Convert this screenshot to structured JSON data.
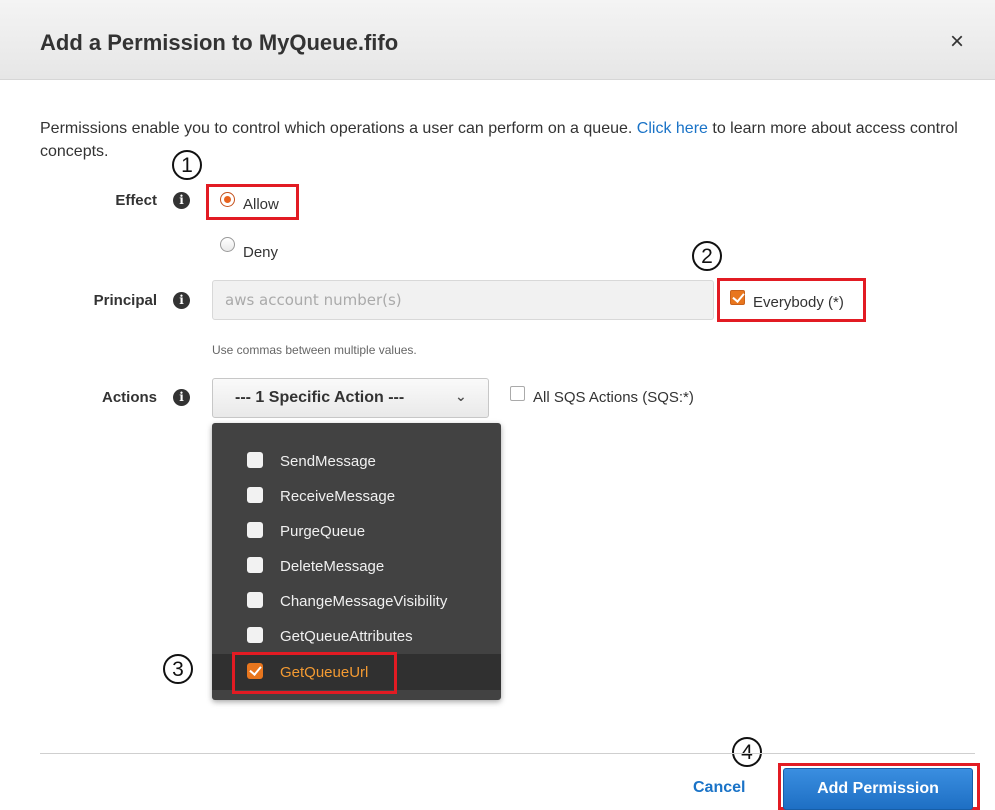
{
  "dialog": {
    "title": "Add a Permission to MyQueue.fifo",
    "close_glyph": "×"
  },
  "description": {
    "text_before": "Permissions enable you to control which operations a user can perform on a queue.",
    "link_text": "Click here",
    "text_after": "to learn more about access control concepts."
  },
  "effect": {
    "label": "Effect",
    "options": [
      {
        "label": "Allow",
        "checked": true
      },
      {
        "label": "Deny",
        "checked": false
      }
    ]
  },
  "principal": {
    "label": "Principal",
    "placeholder": "aws account number(s)",
    "value": "",
    "everybody_label": "Everybody (*)",
    "everybody_checked": true,
    "help": "Use commas between multiple values."
  },
  "actions": {
    "label": "Actions",
    "select_value": "--- 1 Specific Action ---",
    "all_actions_label": "All SQS Actions (SQS:*)",
    "all_actions_checked": false,
    "items": [
      {
        "label": "SendMessage",
        "checked": false
      },
      {
        "label": "ReceiveMessage",
        "checked": false
      },
      {
        "label": "PurgeQueue",
        "checked": false
      },
      {
        "label": "DeleteMessage",
        "checked": false
      },
      {
        "label": "ChangeMessageVisibility",
        "checked": false
      },
      {
        "label": "GetQueueAttributes",
        "checked": false
      },
      {
        "label": "GetQueueUrl",
        "checked": true
      }
    ]
  },
  "annotations": {
    "markers": [
      "1",
      "2",
      "3",
      "4"
    ],
    "highlight_color": "#e21b23"
  },
  "footer": {
    "cancel_label": "Cancel",
    "submit_label": "Add Permission"
  },
  "colors": {
    "accent_orange": "#e8761e",
    "link_blue": "#1a73c7",
    "primary_blue": "#1e6fc4"
  }
}
